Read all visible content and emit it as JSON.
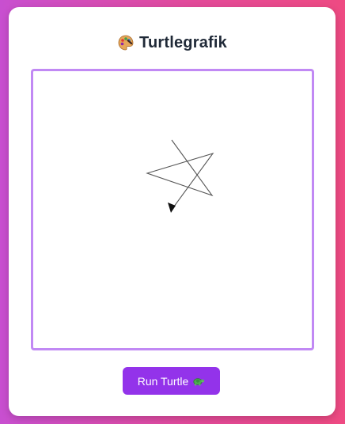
{
  "app": {
    "title": "Turtlegrafik",
    "title_icon": "palette-icon"
  },
  "canvas": {
    "drawing": "five-pointed-star",
    "turtle_cursor": "arrow-cursor-icon",
    "border_color": "#c189f4"
  },
  "controls": {
    "run_label": "Run Turtle",
    "run_icon": "turtle-icon",
    "button_color": "#9333ea"
  },
  "theme": {
    "gradient_start": "#c84fd0",
    "gradient_end": "#ee4a82",
    "card_background": "#ffffff"
  }
}
